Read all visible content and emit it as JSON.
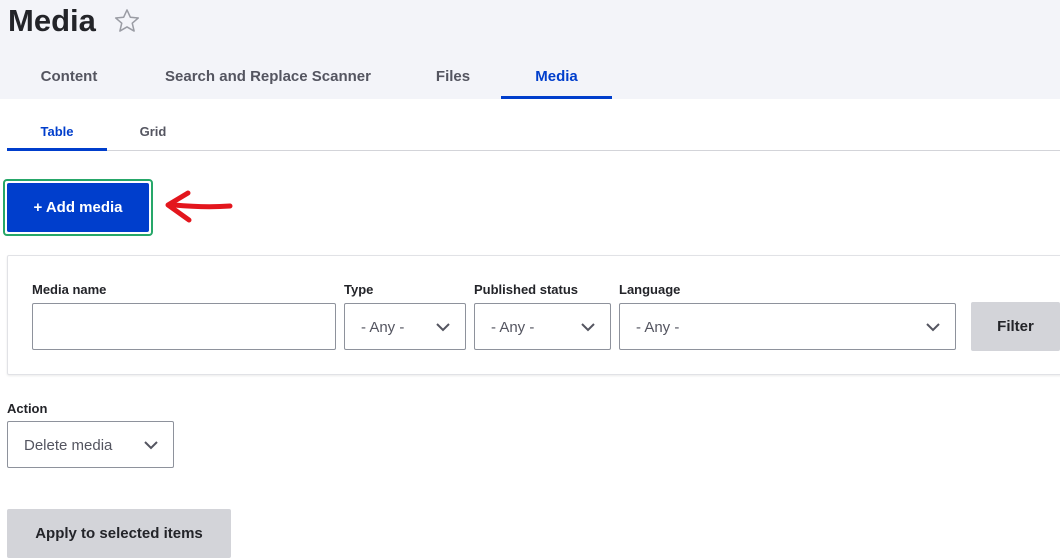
{
  "page": {
    "title": "Media",
    "favorite_icon": "star-outline-icon"
  },
  "primary_tabs": [
    {
      "label": "Content",
      "active": false
    },
    {
      "label": "Search and Replace Scanner",
      "active": false
    },
    {
      "label": "Files",
      "active": false
    },
    {
      "label": "Media",
      "active": true
    }
  ],
  "secondary_tabs": [
    {
      "label": "Table",
      "active": true
    },
    {
      "label": "Grid",
      "active": false
    }
  ],
  "add_media": {
    "label": "+ Add media",
    "annotation_icon": "red-arrow-left-icon"
  },
  "filters": {
    "media_name": {
      "label": "Media name",
      "value": ""
    },
    "type": {
      "label": "Type",
      "selected": "- Any -"
    },
    "published_status": {
      "label": "Published status",
      "selected": "- Any -"
    },
    "language": {
      "label": "Language",
      "selected": "- Any -"
    },
    "filter_button": "Filter"
  },
  "bulk": {
    "action_label": "Action",
    "action_selected": "Delete media",
    "apply_button": "Apply to selected items"
  },
  "colors": {
    "accent": "#003ecc",
    "highlight_border": "#26a769",
    "annotation": "#e3161d",
    "header_bg": "#f3f4f9"
  }
}
